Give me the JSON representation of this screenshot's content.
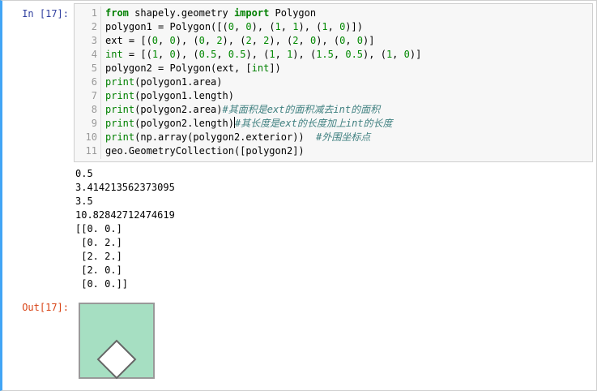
{
  "input_prompt": "In  [17]:",
  "output_prompt": "Out[17]:",
  "code_lines": [
    {
      "n": "1",
      "parts": [
        {
          "t": "from",
          "c": "kw"
        },
        {
          "t": " shapely.geometry ",
          "c": ""
        },
        {
          "t": "import",
          "c": "kw"
        },
        {
          "t": " Polygon",
          "c": ""
        }
      ]
    },
    {
      "n": "2",
      "parts": [
        {
          "t": "polygon1 = Polygon([(",
          "c": ""
        },
        {
          "t": "0",
          "c": "num"
        },
        {
          "t": ", ",
          "c": ""
        },
        {
          "t": "0",
          "c": "num"
        },
        {
          "t": "), (",
          "c": ""
        },
        {
          "t": "1",
          "c": "num"
        },
        {
          "t": ", ",
          "c": ""
        },
        {
          "t": "1",
          "c": "num"
        },
        {
          "t": "), (",
          "c": ""
        },
        {
          "t": "1",
          "c": "num"
        },
        {
          "t": ", ",
          "c": ""
        },
        {
          "t": "0",
          "c": "num"
        },
        {
          "t": ")])",
          "c": ""
        }
      ]
    },
    {
      "n": "3",
      "parts": [
        {
          "t": "ext = [(",
          "c": ""
        },
        {
          "t": "0",
          "c": "num"
        },
        {
          "t": ", ",
          "c": ""
        },
        {
          "t": "0",
          "c": "num"
        },
        {
          "t": "), (",
          "c": ""
        },
        {
          "t": "0",
          "c": "num"
        },
        {
          "t": ", ",
          "c": ""
        },
        {
          "t": "2",
          "c": "num"
        },
        {
          "t": "), (",
          "c": ""
        },
        {
          "t": "2",
          "c": "num"
        },
        {
          "t": ", ",
          "c": ""
        },
        {
          "t": "2",
          "c": "num"
        },
        {
          "t": "), (",
          "c": ""
        },
        {
          "t": "2",
          "c": "num"
        },
        {
          "t": ", ",
          "c": ""
        },
        {
          "t": "0",
          "c": "num"
        },
        {
          "t": "), (",
          "c": ""
        },
        {
          "t": "0",
          "c": "num"
        },
        {
          "t": ", ",
          "c": ""
        },
        {
          "t": "0",
          "c": "num"
        },
        {
          "t": ")]",
          "c": ""
        }
      ]
    },
    {
      "n": "4",
      "parts": [
        {
          "t": "int",
          "c": "bi"
        },
        {
          "t": " = [(",
          "c": ""
        },
        {
          "t": "1",
          "c": "num"
        },
        {
          "t": ", ",
          "c": ""
        },
        {
          "t": "0",
          "c": "num"
        },
        {
          "t": "), (",
          "c": ""
        },
        {
          "t": "0.5",
          "c": "num"
        },
        {
          "t": ", ",
          "c": ""
        },
        {
          "t": "0.5",
          "c": "num"
        },
        {
          "t": "), (",
          "c": ""
        },
        {
          "t": "1",
          "c": "num"
        },
        {
          "t": ", ",
          "c": ""
        },
        {
          "t": "1",
          "c": "num"
        },
        {
          "t": "), (",
          "c": ""
        },
        {
          "t": "1.5",
          "c": "num"
        },
        {
          "t": ", ",
          "c": ""
        },
        {
          "t": "0.5",
          "c": "num"
        },
        {
          "t": "), (",
          "c": ""
        },
        {
          "t": "1",
          "c": "num"
        },
        {
          "t": ", ",
          "c": ""
        },
        {
          "t": "0",
          "c": "num"
        },
        {
          "t": ")]",
          "c": ""
        }
      ]
    },
    {
      "n": "5",
      "parts": [
        {
          "t": "polygon2 = Polygon(ext, [",
          "c": ""
        },
        {
          "t": "int",
          "c": "bi"
        },
        {
          "t": "])",
          "c": ""
        }
      ]
    },
    {
      "n": "6",
      "parts": [
        {
          "t": "print",
          "c": "bi"
        },
        {
          "t": "(polygon1.area)",
          "c": ""
        }
      ]
    },
    {
      "n": "7",
      "parts": [
        {
          "t": "print",
          "c": "bi"
        },
        {
          "t": "(polygon1.length)",
          "c": ""
        }
      ]
    },
    {
      "n": "8",
      "parts": [
        {
          "t": "print",
          "c": "bi"
        },
        {
          "t": "(polygon2.area)",
          "c": ""
        },
        {
          "t": "#其面积是ext的面积减去int的面积",
          "c": "cm"
        }
      ]
    },
    {
      "n": "9",
      "parts": [
        {
          "t": "print",
          "c": "bi"
        },
        {
          "t": "(polygon2.length)",
          "c": ""
        },
        {
          "t": "|",
          "c": "cursor"
        },
        {
          "t": "#其长度是ext的长度加上int的长度",
          "c": "cm"
        }
      ]
    },
    {
      "n": "10",
      "parts": [
        {
          "t": "print",
          "c": "bi"
        },
        {
          "t": "(np.array(polygon2.exterior))  ",
          "c": ""
        },
        {
          "t": "#外围坐标点",
          "c": "cm"
        }
      ]
    },
    {
      "n": "11",
      "parts": [
        {
          "t": "geo.GeometryCollection([polygon2])",
          "c": ""
        }
      ]
    }
  ],
  "output_lines": [
    "0.5",
    "3.414213562373095",
    "3.5",
    "10.82842712474619",
    "[[0. 0.]",
    " [0. 2.]",
    " [2. 2.]",
    " [2. 0.]",
    " [0. 0.]]"
  ],
  "colors": {
    "polygon_fill": "#a6dfc2",
    "polygon_stroke": "#999999",
    "hole_fill": "#ffffff",
    "hole_stroke": "#666666"
  }
}
